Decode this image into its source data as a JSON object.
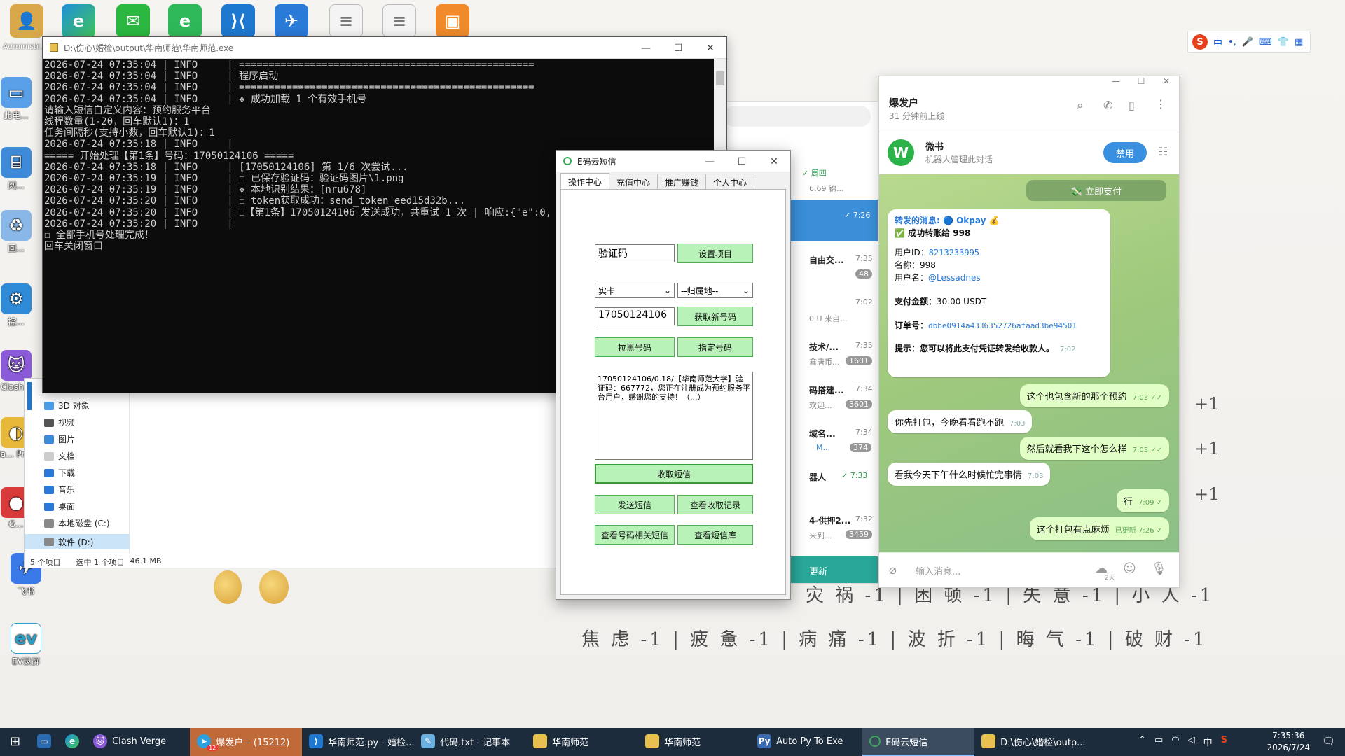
{
  "desktop": {
    "icons_left": [
      {
        "label": "Administr..."
      },
      {
        "label": "此电..."
      },
      {
        "label": "网..."
      },
      {
        "label": "回..."
      },
      {
        "label": "控..."
      },
      {
        "label": "Clash..."
      },
      {
        "label": "Na... Pre..."
      },
      {
        "label": "G..."
      },
      {
        "label": "飞书"
      },
      {
        "label": "EV录屏"
      }
    ]
  },
  "console": {
    "title": "D:\\伤心\\婚检\\output\\华南师范\\华南师范.exe",
    "lines": [
      "2026-07-24 07:35:04 | INFO     | ==================================================",
      "2026-07-24 07:35:04 | INFO     | 程序启动",
      "2026-07-24 07:35:04 | INFO     | ==================================================",
      "2026-07-24 07:35:04 | INFO     | ❖ 成功加载 1 个有效手机号",
      "请输入短信自定义内容：预约服务平台",
      "线程数量(1-20，回车默认1)：1",
      "任务间隔秒(支持小数，回车默认1)：1",
      "2026-07-24 07:35:18 | INFO     |",
      "===== 开始处理【第1条】号码：17050124106 =====",
      "2026-07-24 07:35:18 | INFO     | [17050124106] 第 1/6 次尝试...",
      "2026-07-24 07:35:19 | INFO     | ☐ 已保存验证码：验证码图片\\1.png",
      "2026-07-24 07:35:19 | INFO     | ❖ 本地识别结果：[nru678]",
      "2026-07-24 07:35:20 | INFO     | ☐ token获取成功：send_token_eed15d32b...",
      "2026-07-24 07:35:20 | INFO     | ☐【第1条】17050124106 发送成功，共重试 1 次 | 响应:{\"e\":0,",
      "2026-07-24 07:35:20 | INFO     |",
      "☐ 全部手机号处理完成！",
      "回车关闭窗口"
    ]
  },
  "explorer": {
    "tree": [
      "3D 对象",
      "视频",
      "图片",
      "文档",
      "下载",
      "音乐",
      "桌面",
      "本地磁盘 (C:)",
      "软件 (D:)"
    ],
    "status": {
      "items": "5 个项目",
      "selected": "选中 1 个项目",
      "size": "46.1 MB"
    }
  },
  "tglist": {
    "items": [
      {
        "time": "✓ 周四",
        "preview": "6.69 锦..."
      },
      {
        "time": "✓ 7:26",
        "preview": ""
      },
      {
        "name": "自由交...",
        "time": "7:35",
        "badge": "48"
      },
      {
        "name": "",
        "time": "7:02",
        "preview": "0 U 来自..."
      },
      {
        "name": "技术/...",
        "time": "7:35",
        "preview": "鑫唐币...",
        "badge": "1601"
      },
      {
        "name": "码搭建...",
        "time": "7:34",
        "preview": "欢迎...",
        "badge": "3601"
      },
      {
        "name": "域名...",
        "time": "7:34",
        "preview": "M...",
        "badge": "374"
      },
      {
        "name": "器人",
        "time": "✓ 7:33"
      },
      {
        "name": "4-供押2...",
        "time": "7:32",
        "preview": "来到...",
        "badge": "3459"
      }
    ],
    "update_label": "更新"
  },
  "ema": {
    "title": "E码云短信",
    "tabs": [
      "操作中心",
      "充值中心",
      "推广赚钱",
      "个人中心"
    ],
    "project_input": "验证码",
    "set_project": "设置项目",
    "card_select": "实卡",
    "region_select": "--归属地--",
    "phone_input": "17050124106",
    "get_number": "获取新号码",
    "blacklist": "拉黑号码",
    "specify": "指定号码",
    "sms_text": "17050124106/0.18/【华南师范大学】验证码：667772，您正在注册成为预约服务平台用户，感谢您的支持！（...）",
    "receive": "收取短信",
    "send": "发送短信",
    "view_receive": "查看收取记录",
    "view_related": "查看号码相关短信",
    "view_library": "查看短信库"
  },
  "telegram": {
    "title": "爆发户",
    "subtitle": "31 分钟前上线",
    "pinned_name": "微书",
    "pinned_sub": "机器人管理此对话",
    "pinned_btn": "禁用",
    "pay_btn": "💸 立即支付",
    "forward": {
      "head": "转发的消息: 🔵 Okpay 💰",
      "line1": "✅ 成功转账给 998",
      "uid_label": "用户ID：",
      "uid": "8213233995",
      "name_label": "名称：",
      "name": "998",
      "uname_label": "用户名：",
      "uname": "@Lessadnes",
      "amount_label": "支付金额：",
      "amount": "30.00 USDT",
      "order_label": "订单号：",
      "order": "dbbe0914a4336352726afaad3be94501",
      "tip_label": "提示：",
      "tip": "您可以将此支付凭证转发给收款人。",
      "time": "7:02"
    },
    "messages": [
      {
        "dir": "out",
        "text": "这个也包含新的那个预约",
        "time": "7:03 ✓✓"
      },
      {
        "dir": "in",
        "text": "你先打包，今晚看看跑不跑",
        "time": "7:03"
      },
      {
        "dir": "out",
        "text": "然后就看我下这个怎么样",
        "time": "7:03 ✓✓"
      },
      {
        "dir": "in",
        "text": "看我今天下午什么时候忙完事情",
        "time": "7:03"
      },
      {
        "dir": "out",
        "text": "行",
        "time": "7:09 ✓"
      },
      {
        "dir": "out",
        "text": "这个打包有点麻烦",
        "time": "已更新 7:26 ✓"
      }
    ],
    "input_placeholder": "输入消息...",
    "emoji_badge": "2天"
  },
  "wall": {
    "row1": "灾 祸 -1  |  困 顿 -1  |  失 意 -1  |  小 人 -1",
    "row2": "焦 虑 -1  |  疲 惫 -1  |  病 痛 -1  |  波 折 -1  |  晦 气 -1  |  破 财 -1",
    "plus": [
      "+1",
      "+1",
      "+1"
    ]
  },
  "ime": {
    "label": "中"
  },
  "taskbar": {
    "items": [
      {
        "label": "Clash Verge"
      },
      {
        "label": "爆发户 – (15212)"
      },
      {
        "label": "华南师范.py - 婚检..."
      },
      {
        "label": "代码.txt - 记事本"
      },
      {
        "label": "华南师范"
      },
      {
        "label": "华南师范"
      },
      {
        "label": "Auto Py To Exe"
      },
      {
        "label": "E码云短信"
      },
      {
        "label": "D:\\伤心\\婚检\\outp..."
      }
    ],
    "tg_badge": "12",
    "tray_lang": "中",
    "time": "7:35:36",
    "date": "2026/7/24"
  }
}
